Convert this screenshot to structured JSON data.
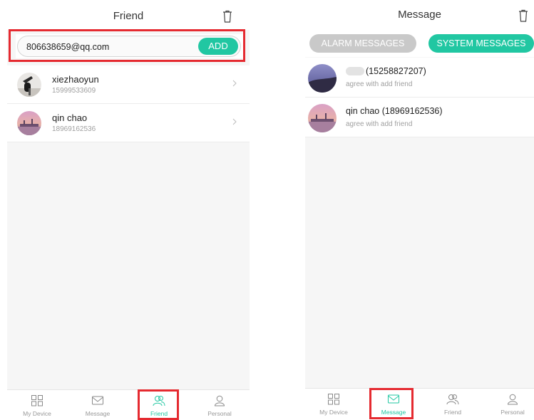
{
  "colors": {
    "accent": "#21c7a2",
    "highlight": "#e52a30",
    "muted_tab": "#c9c9c9"
  },
  "friend_screen": {
    "title": "Friend",
    "search": {
      "value": "806638659@qq.com",
      "button": "ADD"
    },
    "friends": [
      {
        "name": "xiezhaoyun",
        "phone": "15999533609"
      },
      {
        "name": "qin chao",
        "phone": "18969162536"
      }
    ],
    "nav": [
      {
        "label": "My Device",
        "icon": "grid-icon"
      },
      {
        "label": "Message",
        "icon": "envelope-icon"
      },
      {
        "label": "Friend",
        "icon": "friends-icon"
      },
      {
        "label": "Personal",
        "icon": "person-icon"
      }
    ],
    "active_nav": "Friend"
  },
  "message_screen": {
    "title": "Message",
    "tabs": {
      "alarm": "ALARM MESSAGES",
      "system": "SYSTEM MESSAGES"
    },
    "active_tab": "SYSTEM MESSAGES",
    "messages": [
      {
        "name": "(15258827207)",
        "text": "agree with add friend"
      },
      {
        "name": "qin chao (18969162536)",
        "text": "agree with add friend"
      }
    ],
    "nav": [
      {
        "label": "My Device",
        "icon": "grid-icon"
      },
      {
        "label": "Message",
        "icon": "envelope-icon"
      },
      {
        "label": "Friend",
        "icon": "friends-icon"
      },
      {
        "label": "Personal",
        "icon": "person-icon"
      }
    ],
    "active_nav": "Message"
  }
}
